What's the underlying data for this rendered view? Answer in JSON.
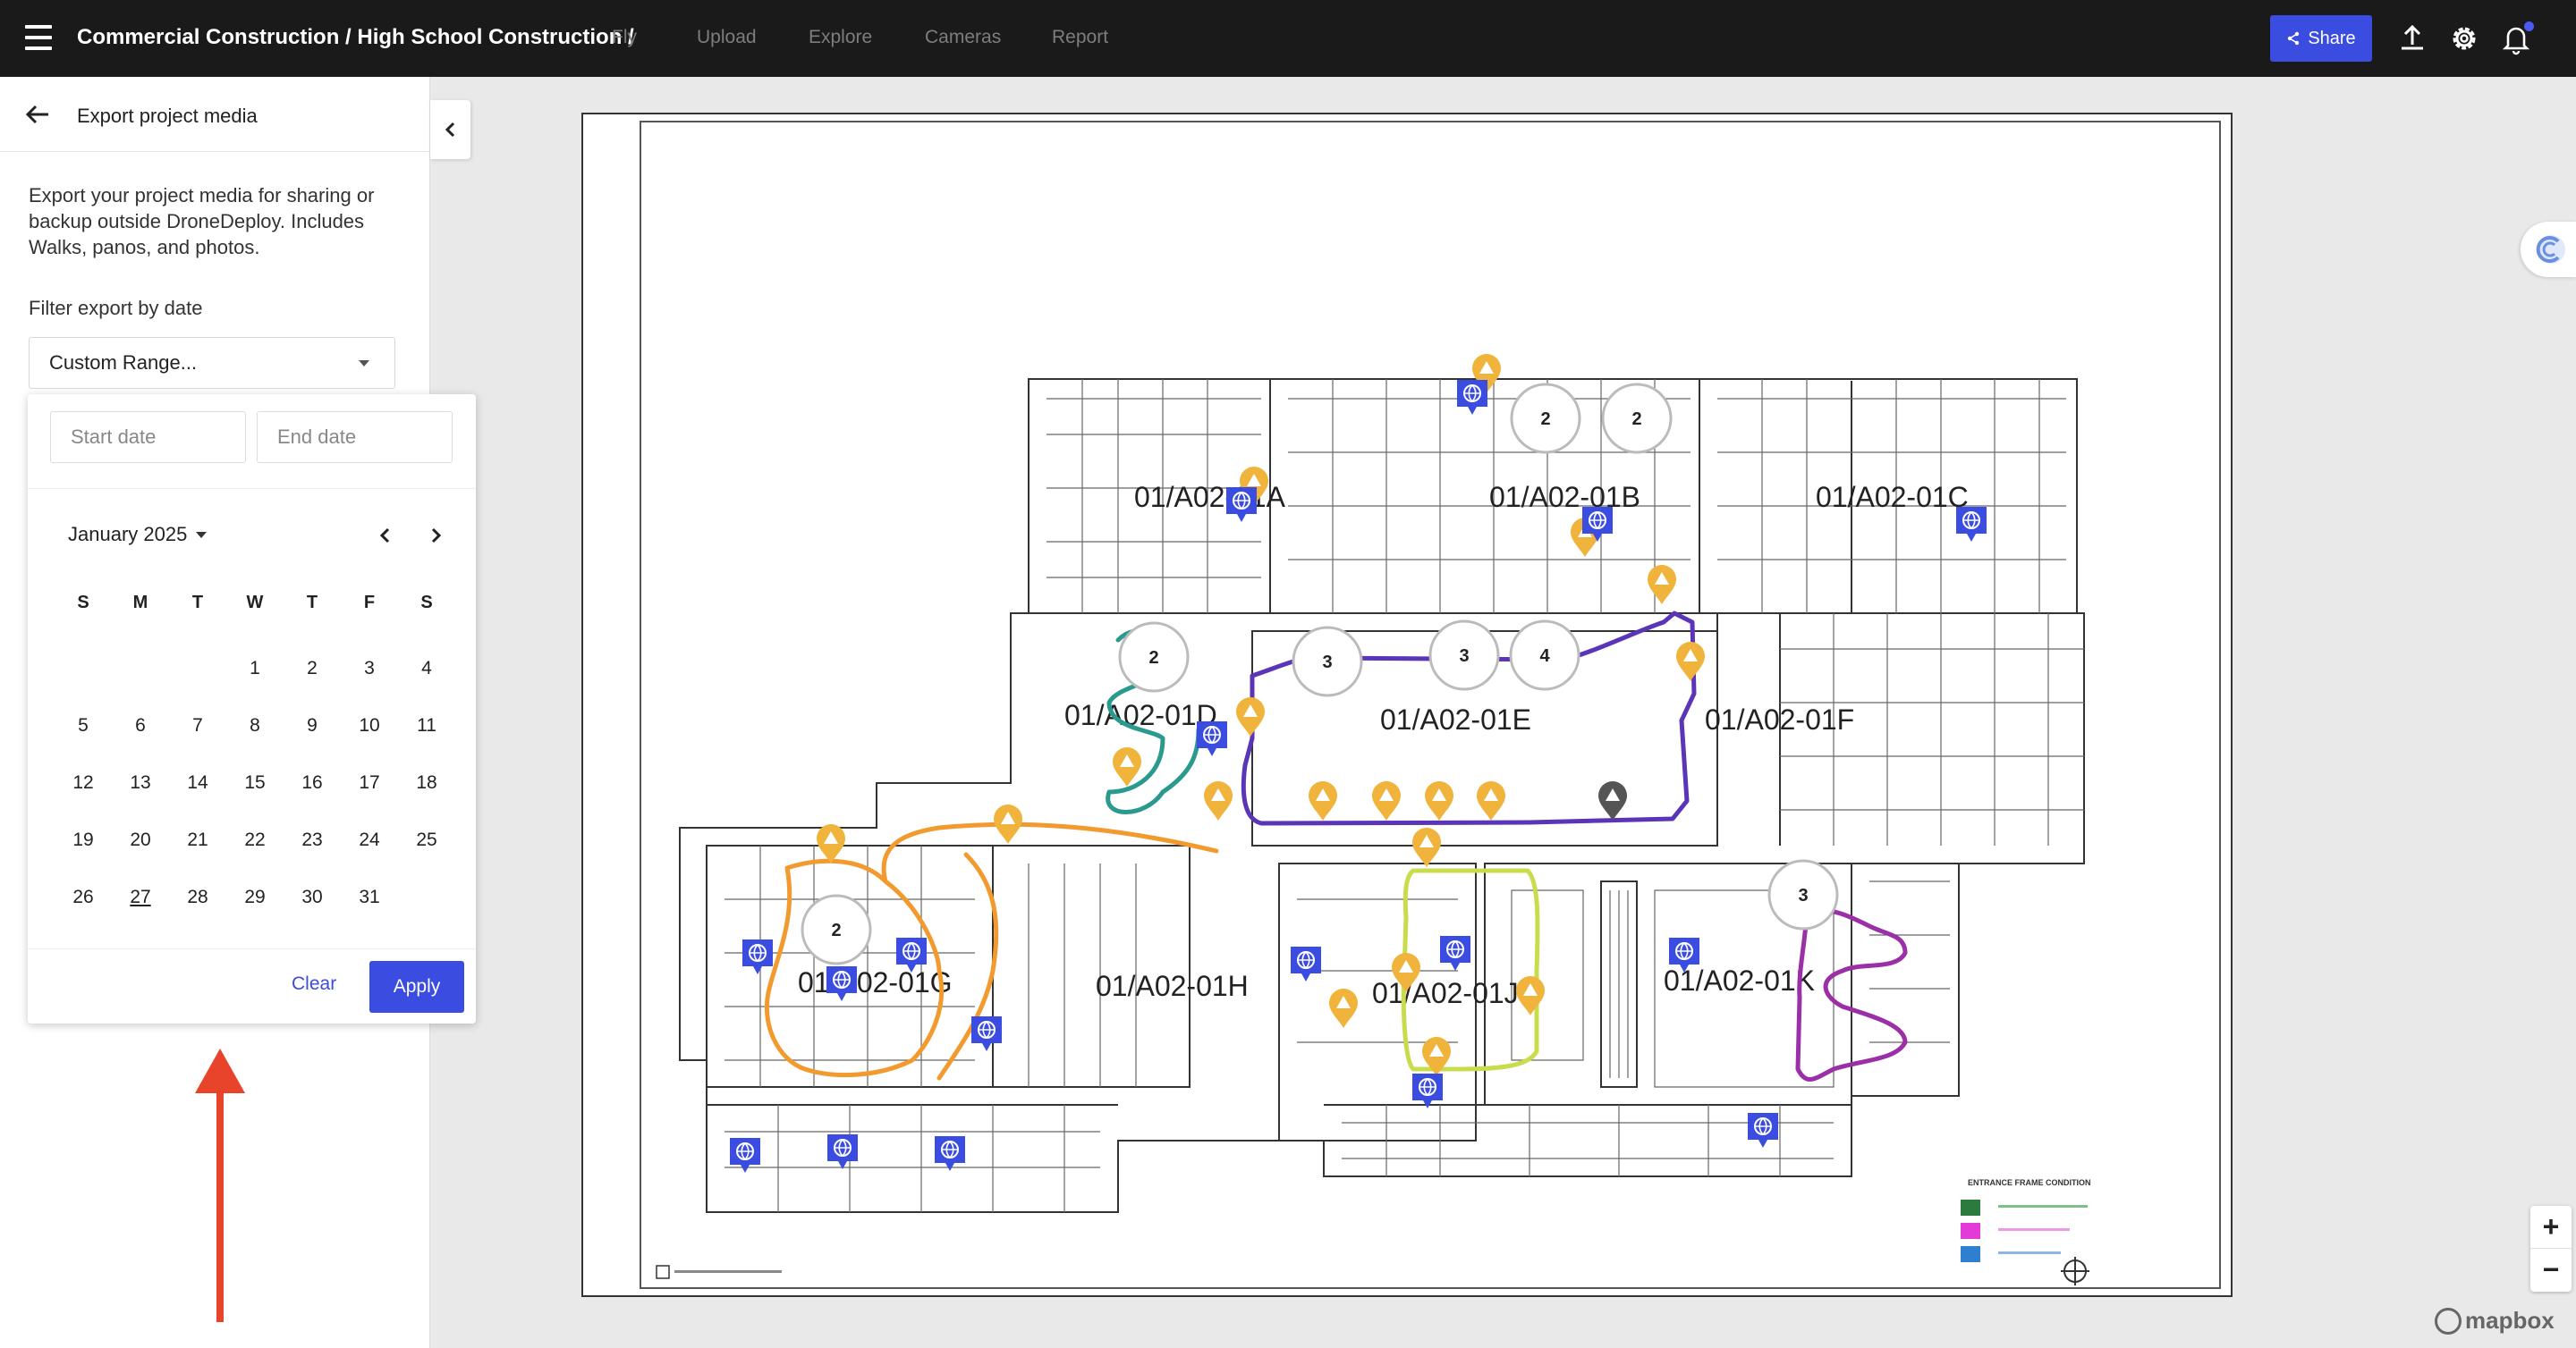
{
  "topbar": {
    "breadcrumb": "Commercial Construction / High School Construction /",
    "nav": [
      "Fly",
      "Upload",
      "Explore",
      "Cameras",
      "Report"
    ],
    "share_label": "Share",
    "icons": [
      "menu-icon",
      "share-icon",
      "upload-icon",
      "gear-icon",
      "bell-icon"
    ]
  },
  "panel": {
    "title": "Export project media",
    "description": "Export your project media for sharing or backup outside DroneDeploy. Includes Walks, panos, and photos.",
    "filter_label": "Filter export by date",
    "filter_value": "Custom Range..."
  },
  "picker": {
    "start_placeholder": "Start date",
    "end_placeholder": "End date",
    "month_label": "January 2025",
    "weekdays": [
      "S",
      "M",
      "T",
      "W",
      "T",
      "F",
      "S"
    ],
    "first_weekday_index": 3,
    "days_in_month": 31,
    "today": 27,
    "clear_label": "Clear",
    "apply_label": "Apply"
  },
  "plan": {
    "area_labels": [
      "01/A02-01A",
      "01/A02-01B",
      "01/A02-01C",
      "01/A02-01D",
      "01/A02-01E",
      "01/A02-01F",
      "01/A02-01G",
      "01/A02-01H",
      "01/A02-01J",
      "01/A02-01K"
    ],
    "cluster_counts": [
      "2",
      "2",
      "2",
      "3",
      "3",
      "4",
      "2",
      "3"
    ],
    "legend_title": "ENTRANCE FRAME CONDITION",
    "colors": {
      "walk_orange": "#f29a2e",
      "walk_teal": "#2a9a8e",
      "walk_purple": "#5b35b8",
      "walk_lime": "#c9dc4b",
      "walk_magenta": "#9b2fa8",
      "pano_pin": "#3b4ce0",
      "issue_pin": "#f0b43c",
      "issue_pin_closed": "#555555",
      "accent": "#3b4ce0"
    }
  },
  "map_controls": {
    "zoom_in": "+",
    "zoom_out": "−",
    "attribution": "mapbox"
  }
}
